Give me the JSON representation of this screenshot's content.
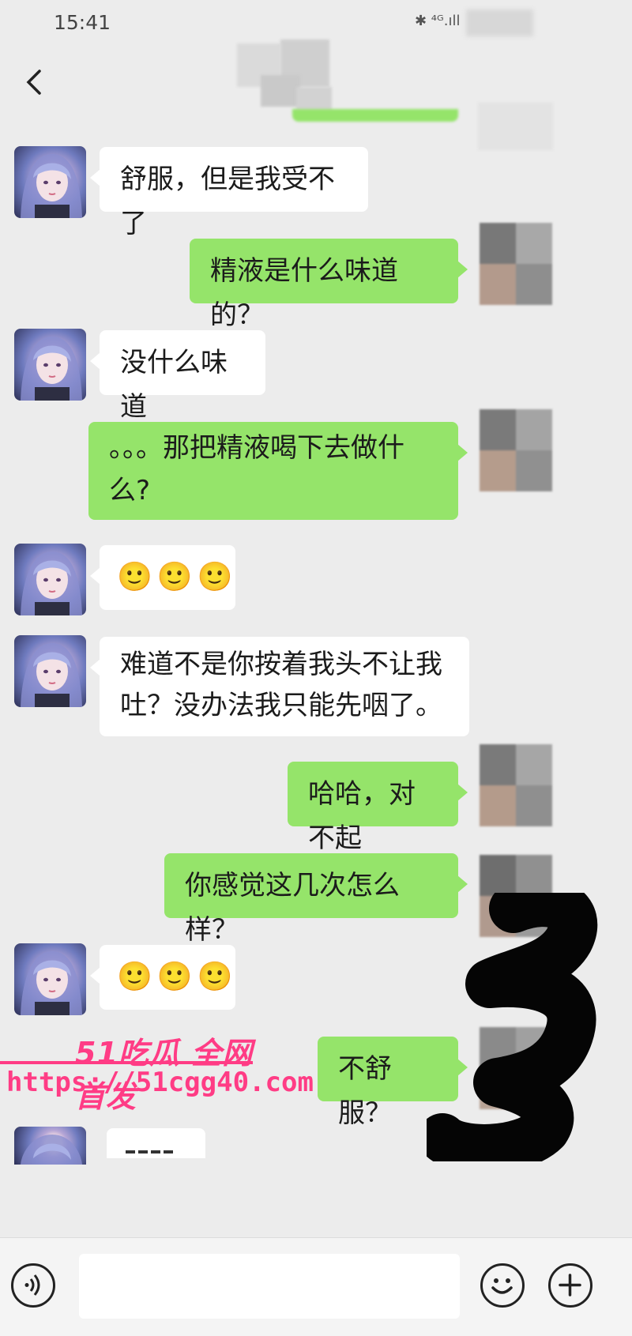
{
  "status_bar": {
    "time": "15:41",
    "signal": "✱ ⁴ᴳ.ıll"
  },
  "header": {
    "back_icon": "chevron-left-icon"
  },
  "messages": [
    {
      "side": "left",
      "text": "舒服，但是我受不了"
    },
    {
      "side": "right",
      "text": "精液是什么味道的？"
    },
    {
      "side": "left",
      "text": "没什么味道"
    },
    {
      "side": "right",
      "text": "。。。那把精液喝下去做什么?"
    },
    {
      "side": "left",
      "emoji": [
        "🙂",
        "🙂",
        "🙂"
      ]
    },
    {
      "side": "left",
      "text": "难道不是你按着我头不让我吐？没办法我只能先咽了。"
    },
    {
      "side": "right",
      "text": "哈哈，对不起"
    },
    {
      "side": "right",
      "text": "你感觉这几次怎么样？"
    },
    {
      "side": "left",
      "emoji": [
        "🙂",
        "🙂",
        "🙂"
      ]
    },
    {
      "side": "right",
      "text": "不舒服？"
    }
  ],
  "watermark": {
    "line1": "51吃瓜 全网首发",
    "line2": "https://51cgg40.com"
  },
  "input_bar": {
    "voice_icon": "voice-icon",
    "emoji_icon": "emoji-icon",
    "plus_icon": "plus-icon"
  },
  "colors": {
    "background": "#ececec",
    "bubble_right": "#95e46a",
    "bubble_left": "#ffffff",
    "watermark": "#ff3c85"
  }
}
